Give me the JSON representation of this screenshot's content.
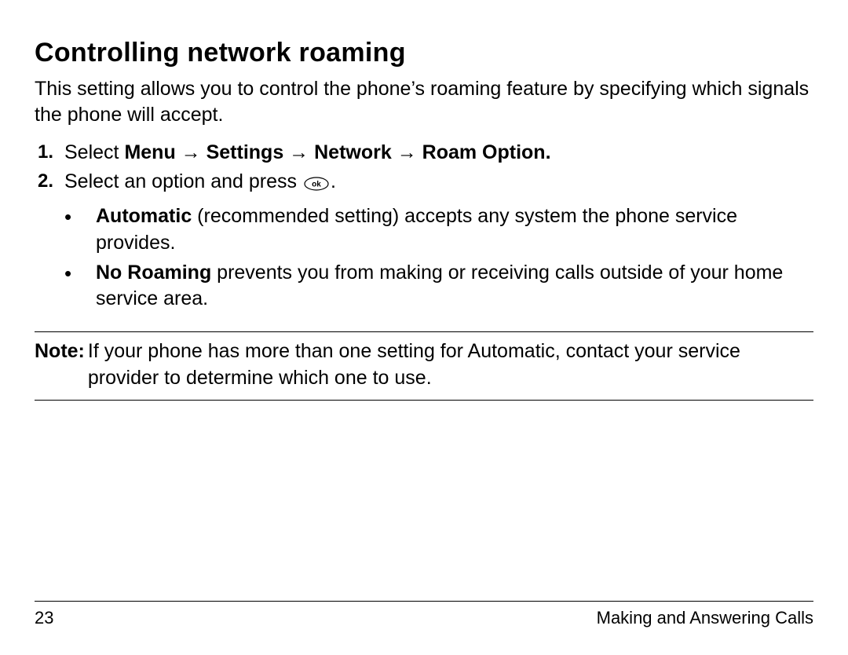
{
  "heading": "Controlling network roaming",
  "intro": "This setting allows you to control the phone’s roaming feature by specifying which signals the phone will accept.",
  "steps": {
    "s1": {
      "prefix": "Select ",
      "menu_path": "Menu → Settings → Network → Roam Option."
    },
    "s2": {
      "prefix": "Select an option and press ",
      "suffix": "."
    }
  },
  "ok_icon_label": "ok",
  "bullets": {
    "b1": {
      "bold": "Automatic",
      "rest": " (recommended setting) accepts any system the phone service provides."
    },
    "b2": {
      "bold": "No Roaming",
      "rest": " prevents you from making or receiving calls outside of your home service area."
    }
  },
  "note": {
    "label": "Note:",
    "text": "If your phone has more than one setting for Automatic, contact your service provider to determine which one to use."
  },
  "footer": {
    "page": "23",
    "section": "Making and Answering Calls"
  }
}
